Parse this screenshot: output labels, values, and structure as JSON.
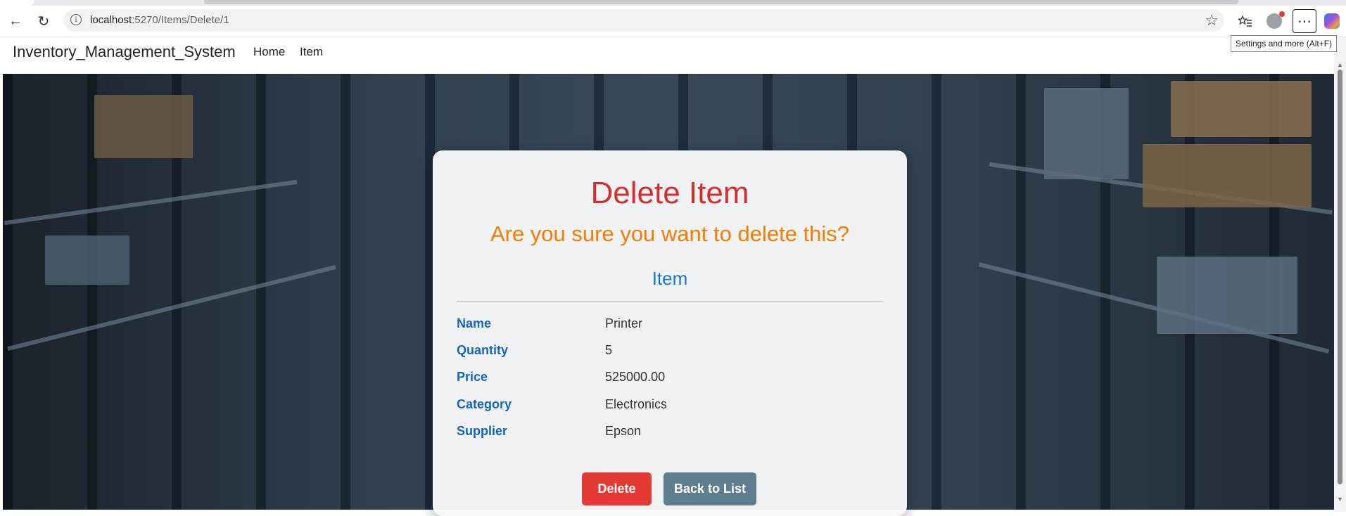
{
  "browser": {
    "url_host": "localhost",
    "url_path": ":5270/Items/Delete/1",
    "tooltip": "Settings and more (Alt+F)",
    "icons": [
      "back-arrow-icon",
      "refresh-icon",
      "info-icon",
      "favorite-star-icon",
      "favorites-list-icon",
      "profile-icon",
      "more-menu-icon",
      "copilot-icon"
    ]
  },
  "navbar": {
    "brand": "Inventory_Management_System",
    "links": [
      "Home",
      "Item"
    ]
  },
  "card": {
    "title": "Delete Item",
    "question": "Are you sure you want to delete this?",
    "section": "Item",
    "fields": [
      {
        "label": "Name",
        "value": "Printer"
      },
      {
        "label": "Quantity",
        "value": "5"
      },
      {
        "label": "Price",
        "value": "525000.00"
      },
      {
        "label": "Category",
        "value": "Electronics"
      },
      {
        "label": "Supplier",
        "value": "Epson"
      }
    ],
    "delete_label": "Delete",
    "back_label": "Back to List"
  },
  "colors": {
    "title": "#d32f2f",
    "question": "#f57c00",
    "section": "#1976d2",
    "field_label": "#1565c0",
    "delete_button": "#e53935",
    "back_button": "#5f7d8e"
  }
}
